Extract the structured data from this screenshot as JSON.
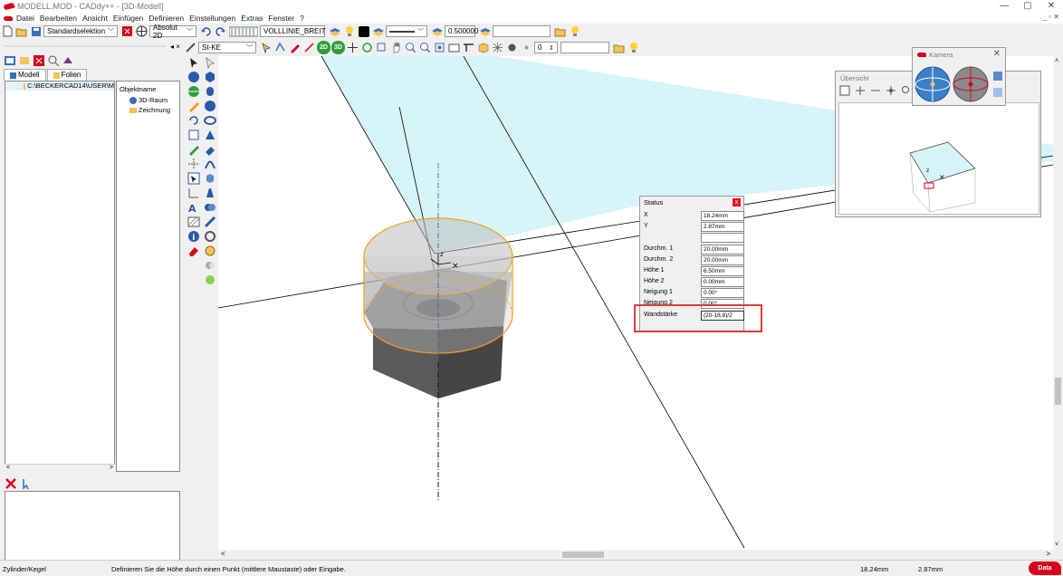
{
  "window": {
    "title": "MODELL.MOD - CADdy++ - [3D-Modell]",
    "controls": [
      "—",
      "▢",
      "✕"
    ],
    "mdi_controls": "_ ▫ ✕"
  },
  "menu": {
    "items": [
      "Datei",
      "Bearbeiten",
      "Ansicht",
      "Einfügen",
      "Definieren",
      "Einstellungen",
      "Extras",
      "Fenster",
      "?"
    ]
  },
  "toolbar1": {
    "selection_mode": "Standardselektion",
    "coord_mode": "Absolut 2D",
    "linetype_combo": "VOLLLINIE_BREIT",
    "lineweight_value": "0.500000",
    "empty_field": ""
  },
  "toolbar2": {
    "material_combo": "St-KE",
    "btn_2d": "2D",
    "btn_3d": "3D",
    "number_value": "0",
    "empty_field": ""
  },
  "left_panel": {
    "tabs": [
      "Modell",
      "Folien"
    ],
    "tree_path": "C:\\BECKERCAD14\\USER\\M",
    "object_header": "Objektname",
    "objects": [
      "3D-Raum",
      "Zeichnung"
    ]
  },
  "status_dialog": {
    "title": "Status",
    "close": "x",
    "rows": [
      {
        "label": "X",
        "value": "18.24mm"
      },
      {
        "label": "Y",
        "value": "2.87mm"
      },
      {
        "label": "",
        "value": ""
      },
      {
        "label": "Durchm. 1",
        "value": "20.00mm"
      },
      {
        "label": "Durchm. 2",
        "value": "20.00mm"
      },
      {
        "label": "Höhe 1",
        "value": "6.50mm"
      },
      {
        "label": "Höhe 2",
        "value": "0.00mm"
      },
      {
        "label": "Neigung 1",
        "value": "0.00°"
      },
      {
        "label": "Neigung 2",
        "value": "0.00°"
      },
      {
        "label": "Wandstärke",
        "value": "(20-18,8)/2"
      }
    ]
  },
  "overview": {
    "title": "Übersicht"
  },
  "camera": {
    "title": "Kamera",
    "close": "✕"
  },
  "statusbar": {
    "mode": "Zylinder/Kegel",
    "message": "Definieren Sie die Höhe durch einen Punkt (mittlere Maustaste) oder Eingabe.",
    "x": "18.24mm",
    "y": "2.87mm",
    "brand": "Data"
  },
  "colors": {
    "accent": "#d6001c",
    "plane": "#d7f4f8",
    "highlight": "#e03a3a",
    "selection": "#f0a020"
  }
}
